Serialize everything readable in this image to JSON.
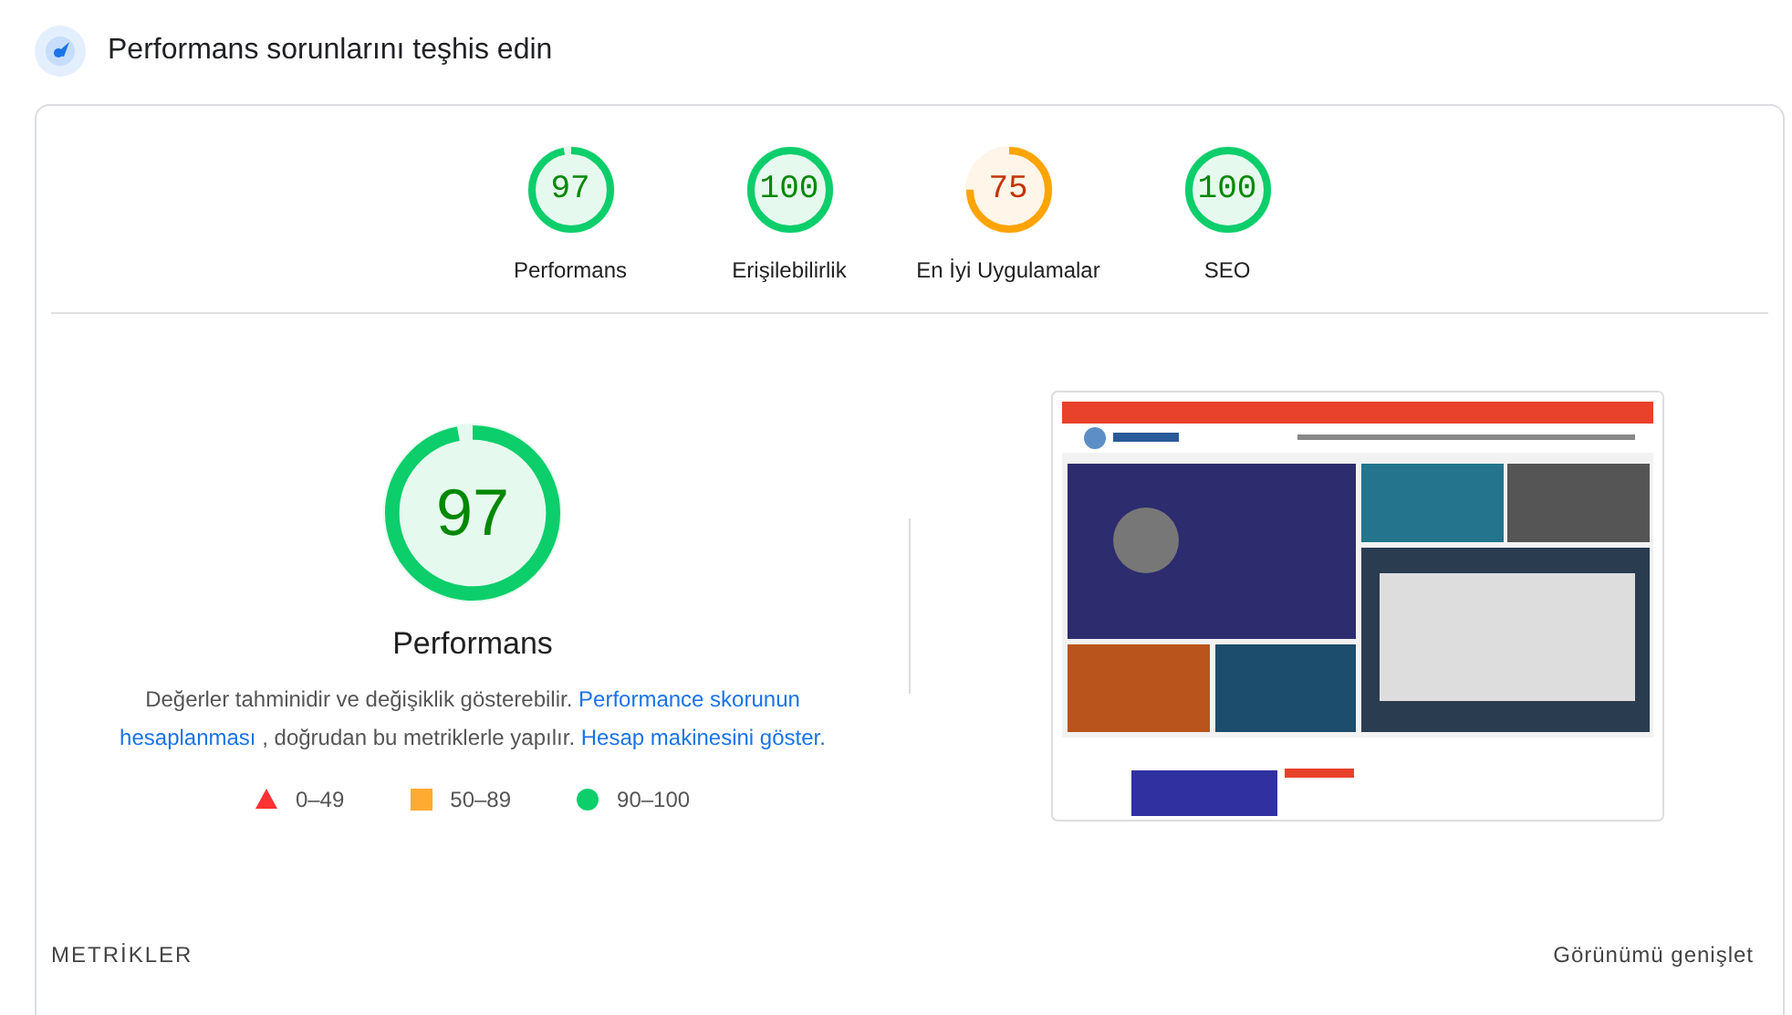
{
  "header": {
    "title": "Performans sorunlarını teşhis edin"
  },
  "gauges": [
    {
      "score": "97",
      "label": "Performans",
      "level": 0.97
    },
    {
      "score": "100",
      "label": "Erişilebilirlik",
      "level": 1
    },
    {
      "score": "75",
      "label": "En İyi Uygulamalar",
      "level": 0.75
    },
    {
      "score": "100",
      "label": "SEO",
      "level": 1
    }
  ],
  "main_gauge": {
    "score": "97",
    "label": "Performans",
    "level": 0.97
  },
  "description": [
    {
      "kind": "text",
      "text": "Değerler tahminidir ve değişiklik gösterebilir."
    },
    {
      "kind": "link",
      "text": "Performance skorunun"
    },
    {
      "kind": "link",
      "text": "hesaplanması"
    },
    {
      "kind": "text",
      "text": ", doğrudan bu metriklerle yapılır."
    },
    {
      "kind": "link",
      "text": "Hesap makinesini göster."
    }
  ],
  "legend": [
    {
      "kind": "triangle",
      "range": "0–49"
    },
    {
      "kind": "square",
      "range": "50–89"
    },
    {
      "kind": "circle",
      "range": "90–100"
    }
  ],
  "footer": {
    "section_title": "METRİKLER",
    "toggle": "Görünümü genişlet"
  }
}
